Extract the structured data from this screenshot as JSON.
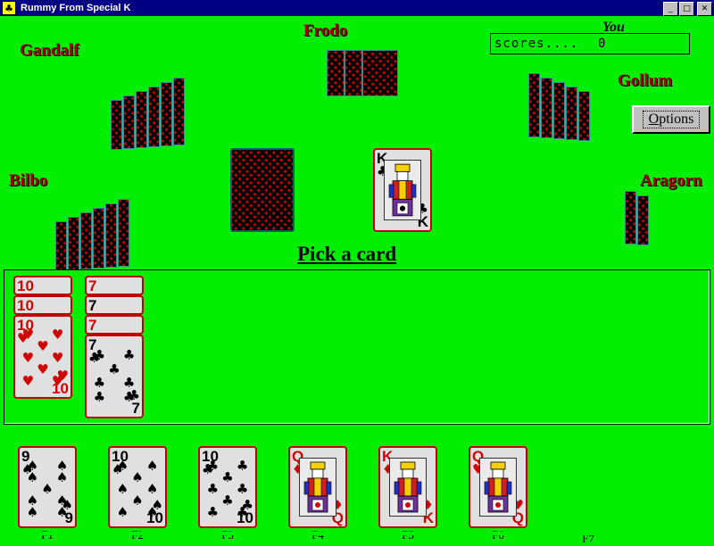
{
  "window": {
    "title": "Rummy From Special K",
    "icon": "club-icon",
    "buttons": {
      "minimize": "_",
      "maximize": "□",
      "close": "✕"
    },
    "titlebar_color": "#000082"
  },
  "board": {
    "felt_color": "#00ee00",
    "prompt": "Pick a card"
  },
  "score": {
    "you_label": "You",
    "caption": "scores....",
    "value": "0"
  },
  "options_button": {
    "label_before": "O",
    "label_after": "ptions"
  },
  "players": [
    {
      "name": "Gandalf",
      "cards": 6,
      "style": "fan-right"
    },
    {
      "name": "Frodo",
      "cards": 3,
      "style": "upright"
    },
    {
      "name": "Gollum",
      "cards": 5,
      "style": "fan-left"
    },
    {
      "name": "Bilbo",
      "cards": 6,
      "style": "fan-right"
    },
    {
      "name": "Aragorn",
      "cards": 2,
      "style": "fan-left"
    }
  ],
  "piles": {
    "stock_label": "stock-pile",
    "discard": {
      "rank": "K",
      "suit": "♣",
      "color": "black"
    }
  },
  "melds": [
    {
      "name": "meld-tens",
      "hidden": [
        {
          "rank": "10",
          "color": "red"
        },
        {
          "rank": "10",
          "color": "red"
        }
      ],
      "top": {
        "rank": "10",
        "suit": "♥",
        "color": "red",
        "pips": 10
      }
    },
    {
      "name": "meld-sevens",
      "hidden": [
        {
          "rank": "7",
          "color": "red"
        },
        {
          "rank": "7",
          "color": "black"
        },
        {
          "rank": "7",
          "color": "red"
        }
      ],
      "top": {
        "rank": "7",
        "suit": "♣",
        "color": "black",
        "pips": 7
      }
    }
  ],
  "hand": [
    {
      "key": "F1",
      "rank": "9",
      "suit": "♠",
      "color": "black",
      "pips": 9,
      "court": false,
      "empty": false
    },
    {
      "key": "F2",
      "rank": "10",
      "suit": "♠",
      "color": "black",
      "pips": 10,
      "court": false,
      "empty": false
    },
    {
      "key": "F3",
      "rank": "10",
      "suit": "♣",
      "color": "black",
      "pips": 10,
      "court": false,
      "empty": false
    },
    {
      "key": "F4",
      "rank": "Q",
      "suit": "♦",
      "color": "red",
      "pips": 0,
      "court": true,
      "empty": false
    },
    {
      "key": "F5",
      "rank": "K",
      "suit": "♦",
      "color": "red",
      "pips": 0,
      "court": true,
      "empty": false
    },
    {
      "key": "F6",
      "rank": "Q",
      "suit": "♥",
      "color": "red",
      "pips": 0,
      "court": true,
      "empty": false
    },
    {
      "key": "F7",
      "rank": "",
      "suit": "",
      "color": "black",
      "pips": 0,
      "court": false,
      "empty": true
    }
  ]
}
